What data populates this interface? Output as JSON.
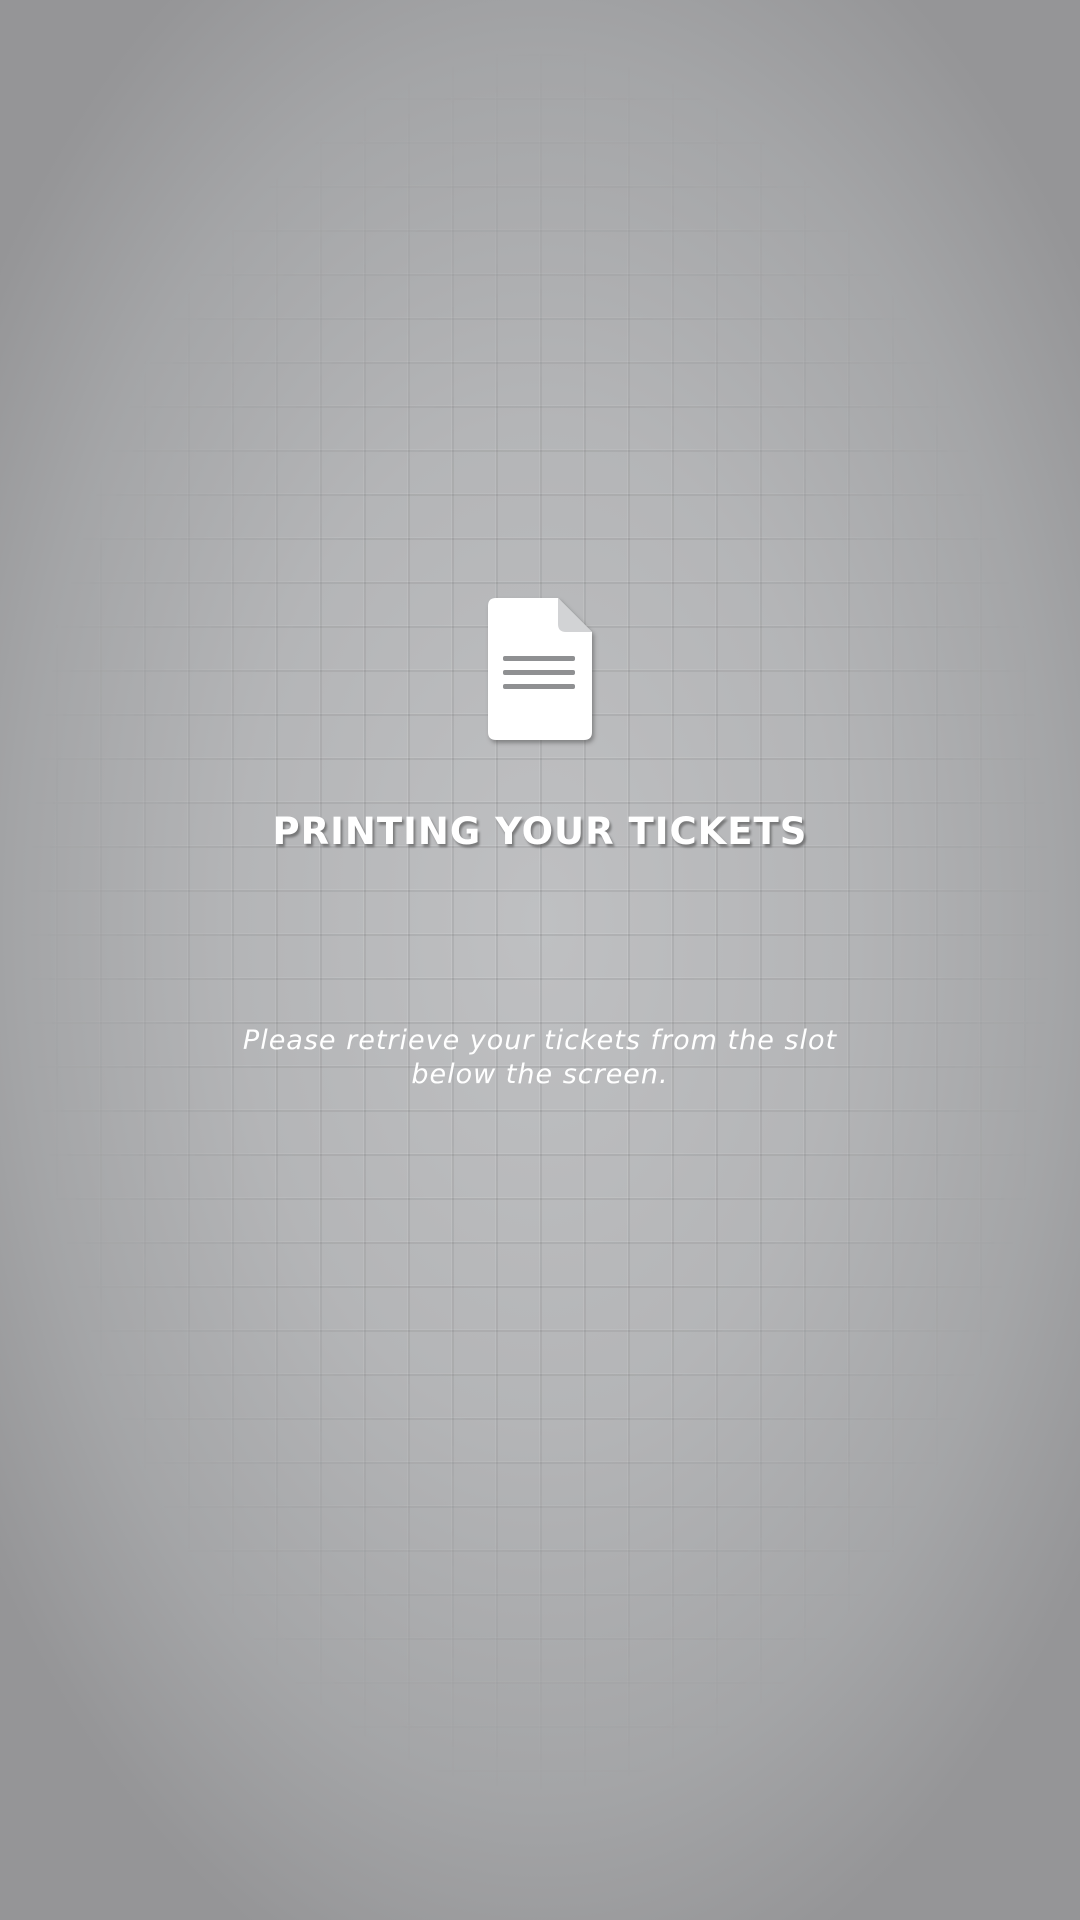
{
  "screen": {
    "title": "PRINTING YOUR TICKETS",
    "message": "Please retrieve your tickets from the slot below the screen.",
    "icon": "document-icon"
  },
  "colors": {
    "text": "#ffffff",
    "background_center": "#bfc0c2",
    "background_edge": "#959597",
    "icon_fill": "#ffffff",
    "icon_lines": "#8f9092"
  }
}
